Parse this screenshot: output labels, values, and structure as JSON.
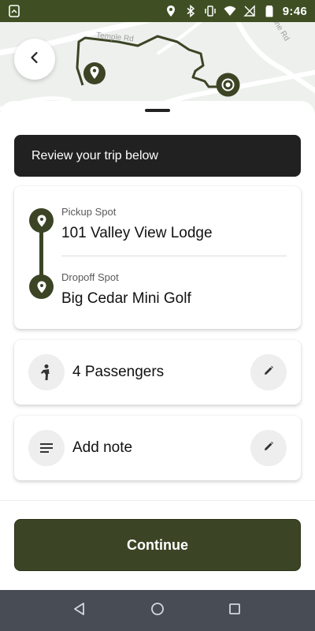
{
  "status_bar": {
    "time": "9:46",
    "icons": [
      "sim-card-icon",
      "location-icon",
      "bluetooth-icon",
      "vibrate-icon",
      "wifi-icon",
      "no-signal-icon",
      "battery-icon"
    ]
  },
  "map": {
    "road_labels": [
      "Temple Rd",
      "one Rd"
    ],
    "route_color": "#3b4525"
  },
  "trip": {
    "banner": "Review your trip below",
    "pickup_label": "Pickup Spot",
    "pickup_value": "101 Valley View Lodge",
    "dropoff_label": "Dropoff Spot",
    "dropoff_value": "Big Cedar Mini Golf"
  },
  "options": {
    "passengers_label": "4 Passengers",
    "note_label": "Add note"
  },
  "actions": {
    "continue_label": "Continue"
  },
  "colors": {
    "accent": "#3b4525",
    "banner_bg": "#212121",
    "status_bar_bg": "#3f4f23",
    "nav_bar_bg": "#474c55"
  }
}
